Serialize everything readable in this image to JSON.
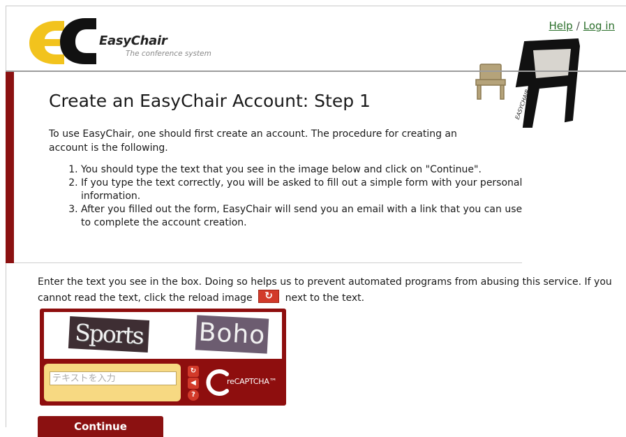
{
  "header": {
    "logo_name": "EasyChair",
    "logo_tagline": "The conference system",
    "help_link": "Help",
    "separator": "/",
    "login_link": "Log in"
  },
  "main": {
    "title": "Create an EasyChair Account: Step 1",
    "intro": "To use EasyChair, one should first create an account. The procedure for creating an account is the following.",
    "steps": [
      "You should type the text that you see in the image below and click on \"Continue\".",
      "If you type the text correctly, you will be asked to fill out a simple form with your personal information.",
      "After you filled out the form, EasyChair will send you an email with a link that you can use to complete the account creation."
    ],
    "captcha_help_before": "Enter the text you see in the box. Doing so helps us to prevent automated programs from abusing this service. If you cannot read the text, click the reload image",
    "captcha_help_after": "next to the text."
  },
  "captcha": {
    "word1": "Sports",
    "word2": "Boho",
    "input_placeholder": "テキストを入力",
    "brand": "reCAPTCHA™"
  },
  "actions": {
    "continue_label": "Continue"
  },
  "colors": {
    "accent_red": "#8b1111",
    "link_green": "#2a6e2a",
    "logo_yellow": "#f2c31d"
  }
}
